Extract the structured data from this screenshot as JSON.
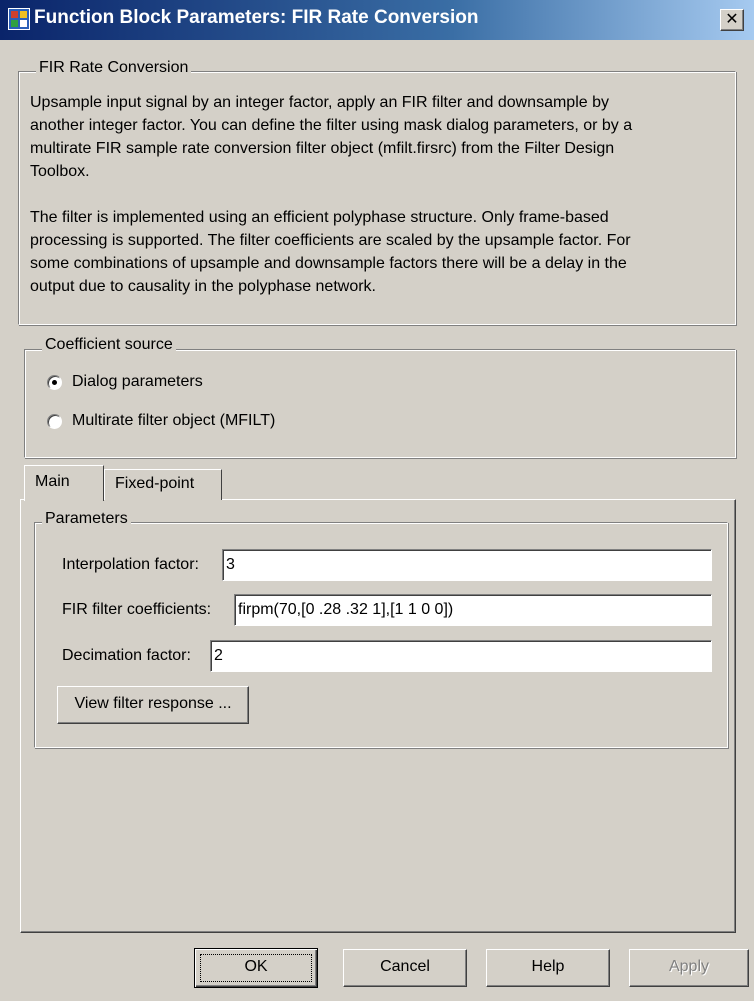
{
  "window": {
    "title": "Function Block Parameters: FIR Rate Conversion",
    "close_symbol": "✕"
  },
  "description": {
    "legend": "FIR Rate Conversion",
    "paragraph1_lines": [
      "Upsample input signal by an integer factor, apply an FIR filter and downsample by",
      "another integer factor. You can define the filter using mask dialog parameters, or by a",
      "multirate FIR sample rate conversion filter object (mfilt.firsrc) from the Filter Design",
      "Toolbox."
    ],
    "paragraph2_lines": [
      "The filter is implemented using an efficient polyphase structure. Only frame-based",
      "processing is supported. The filter coefficients are scaled by the upsample factor. For",
      "some combinations of upsample and downsample factors there will be a delay in the",
      "output due to causality in the polyphase network."
    ]
  },
  "coefficient_source": {
    "legend": "Coefficient source",
    "options": [
      "Dialog parameters",
      "Multirate filter object (MFILT)"
    ],
    "selected": "Dialog parameters"
  },
  "tabs": [
    "Main",
    "Fixed-point"
  ],
  "active_tab": "Main",
  "parameters": {
    "legend": "Parameters",
    "interpolation_label": "Interpolation factor:",
    "interpolation_value": "3",
    "coefficients_label": "FIR filter coefficients:",
    "coefficients_value": "firpm(70,[0 .28 .32 1],[1 1 0 0])",
    "decimation_label": "Decimation factor:",
    "decimation_value": "2",
    "view_response_label": "View filter response ..."
  },
  "buttons": {
    "ok": "OK",
    "cancel": "Cancel",
    "help": "Help",
    "apply": "Apply"
  },
  "colors": {
    "titlebar_start": "#0a246a",
    "titlebar_end": "#a6caf0",
    "dialog_bg": "#d4d0c8"
  },
  "icons": {
    "app": "simulink-block-icon",
    "close": "close-icon"
  }
}
